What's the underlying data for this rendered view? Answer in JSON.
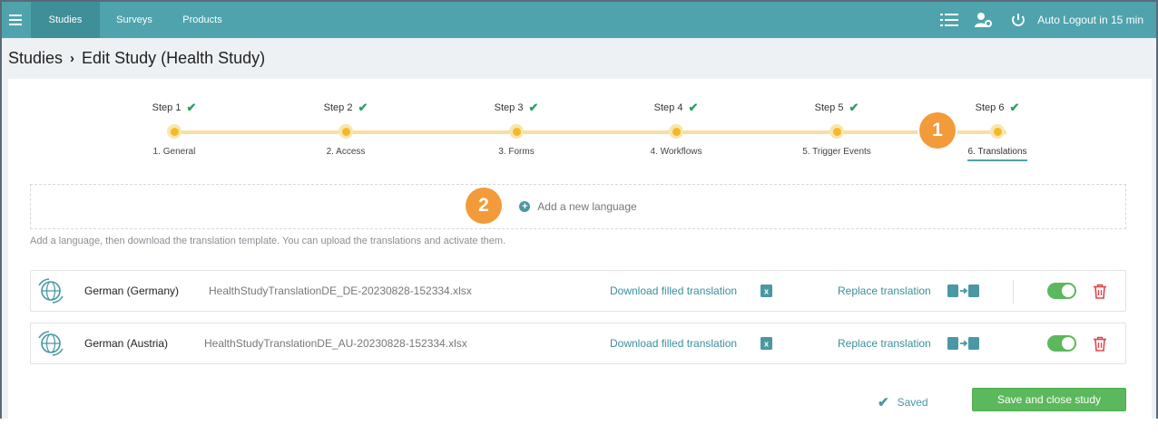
{
  "nav": {
    "tabs": [
      "Studies",
      "Surveys",
      "Products"
    ],
    "auto_logout": "Auto Logout in 15 min",
    "icons": [
      "menu-icon",
      "list-icon",
      "user-settings-icon",
      "power-icon"
    ]
  },
  "breadcrumb": {
    "root": "Studies",
    "current": "Edit Study (Health Study)"
  },
  "steps": [
    {
      "title": "Step 1",
      "name": "1. General"
    },
    {
      "title": "Step 2",
      "name": "2. Access"
    },
    {
      "title": "Step 3",
      "name": "3. Forms"
    },
    {
      "title": "Step 4",
      "name": "4. Workflows"
    },
    {
      "title": "Step 5",
      "name": "5. Trigger Events"
    },
    {
      "title": "Step 6",
      "name": "6. Translations"
    }
  ],
  "active_step": 6,
  "badges": {
    "one": "1",
    "two": "2"
  },
  "add_language": {
    "label": "Add a new language"
  },
  "hint": "Add a language, then download the translation template. You can upload the translations and activate them.",
  "languages": [
    {
      "name": "German (Germany)",
      "file": "HealthStudyTranslationDE_DE-20230828-152334.xlsx",
      "download": "Download filled translation",
      "replace": "Replace translation",
      "active": true
    },
    {
      "name": "German (Austria)",
      "file": "HealthStudyTranslationDE_AU-20230828-152334.xlsx",
      "download": "Download filled translation",
      "replace": "Replace translation",
      "active": true
    }
  ],
  "footer": {
    "saved": "Saved",
    "save_close": "Save and close study"
  },
  "colors": {
    "brand": "#4fa3ad",
    "accent": "#f39b3a",
    "success": "#5cb85c",
    "delete": "#e0474c",
    "step": "#f5b928"
  }
}
